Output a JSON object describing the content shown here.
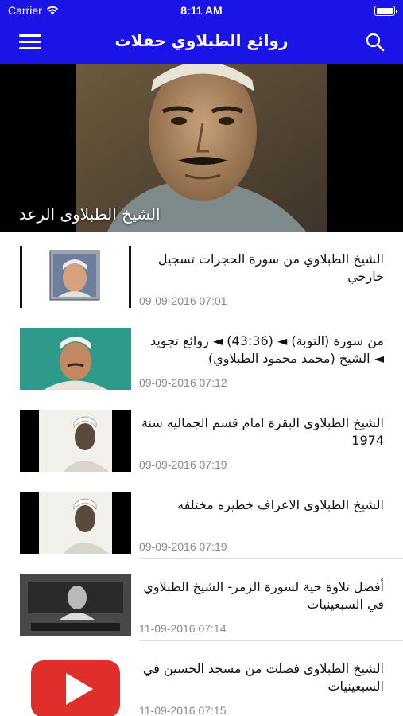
{
  "status_bar": {
    "carrier": "Carrier",
    "time": "8:11 AM"
  },
  "nav": {
    "title": "روائع الطبلاوي حفلات",
    "menu_icon": "hamburger-menu-icon",
    "search_icon": "search-icon",
    "background_color": "#1a14e6"
  },
  "hero": {
    "caption": "الشيخ الطبلاوى الرعد"
  },
  "videos": [
    {
      "title": "الشيخ الطبلاوي من سورة الحجرات تسجيل خارجي",
      "date": "09-09-2016 07:01"
    },
    {
      "title": "من سورة (التوبة) ◄ (43:36) ◄ روائع تجويد ◄ الشيخ (محمد محمود الطبلاوي)",
      "date": "09-09-2016 07:12"
    },
    {
      "title": "الشيخ الطبلاوى البقرة امام قسم الجماليه سنة 1974",
      "date": "09-09-2016 07:19"
    },
    {
      "title": "الشيخ الطبلاوى الاعراف خطيره مختلفه",
      "date": "09-09-2016 07:19"
    },
    {
      "title": "أفضل تلاوة حية لسورة الزمر- الشيخ الطبلاوي في السبعينيات",
      "date": "11-09-2016 07:14"
    },
    {
      "title": "الشيخ الطبلاوى فصلت من مسجد الحسين في السبعينيات",
      "date": "11-09-2016 07:15"
    }
  ]
}
